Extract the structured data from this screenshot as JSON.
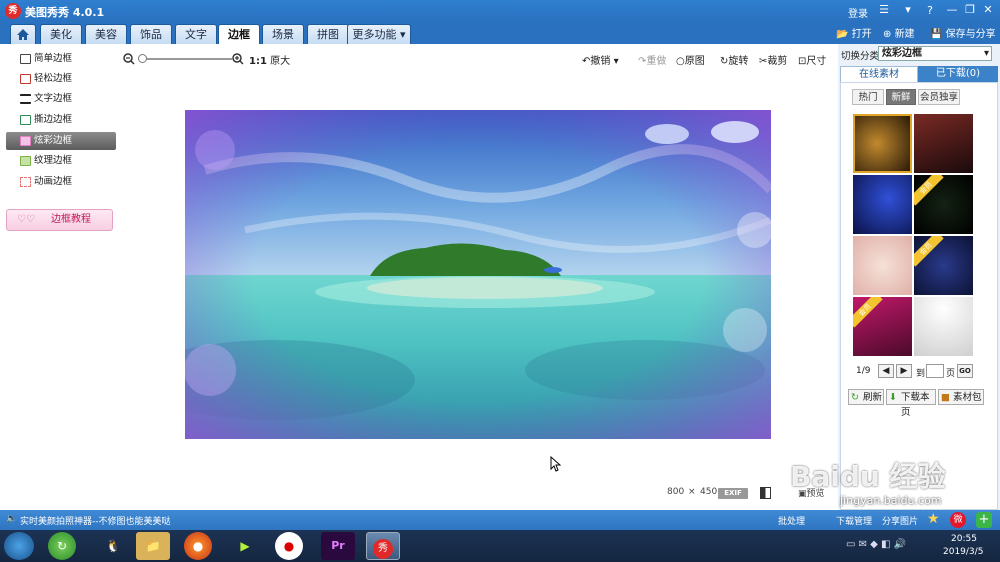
{
  "app": {
    "title": "美图秀秀 4.0.1",
    "logo_text": "秀",
    "login": "登录"
  },
  "tabs": [
    {
      "label": "美化"
    },
    {
      "label": "美容"
    },
    {
      "label": "饰品"
    },
    {
      "label": "文字"
    },
    {
      "label": "边框"
    },
    {
      "label": "场景"
    },
    {
      "label": "拼图"
    },
    {
      "label": "更多功能"
    }
  ],
  "top_actions": {
    "open": "打开",
    "new": "新建",
    "save_share": "保存与分享"
  },
  "left_menu": {
    "items": [
      {
        "label": "简单边框"
      },
      {
        "label": "轻松边框"
      },
      {
        "label": "文字边框"
      },
      {
        "label": "撕边边框"
      },
      {
        "label": "炫彩边框"
      },
      {
        "label": "纹理边框"
      },
      {
        "label": "动画边框"
      }
    ],
    "active_index": 4,
    "tutorial": "边框教程"
  },
  "toolbar": {
    "zoom_ratio": "1:1",
    "zoom_original": "原大",
    "undo": "撤销",
    "redo": "重做",
    "original": "原图",
    "rotate": "旋转",
    "crop": "裁剪",
    "size": "尺寸"
  },
  "status_info": {
    "width": "800",
    "times": "×",
    "height": "450",
    "exif": "EXIF",
    "preview": "预览"
  },
  "right_panel": {
    "category_label": "切换分类",
    "category_value": "炫彩边框",
    "tabs": [
      "在线素材",
      "已下载(0)"
    ],
    "subtabs": [
      "热门",
      "新鲜",
      "会员独享"
    ],
    "vip_badge": "会员",
    "page_info": "1/9",
    "goto_label": "到",
    "page_unit": "页",
    "go": "GO",
    "refresh": "刷新",
    "download_page": "下载本页",
    "material_pack": "素材包"
  },
  "statusbar": {
    "ticker": "实时美颜拍照神器--不修图也能美美哒",
    "batch": "批处理",
    "download_mgr": "下载管理",
    "share": "分享图片"
  },
  "taskbar": {
    "time": "20:55",
    "date": "2019/3/5"
  },
  "watermark": {
    "line1": "Baidu 经验",
    "line2": "jingyan.baidu.com"
  }
}
